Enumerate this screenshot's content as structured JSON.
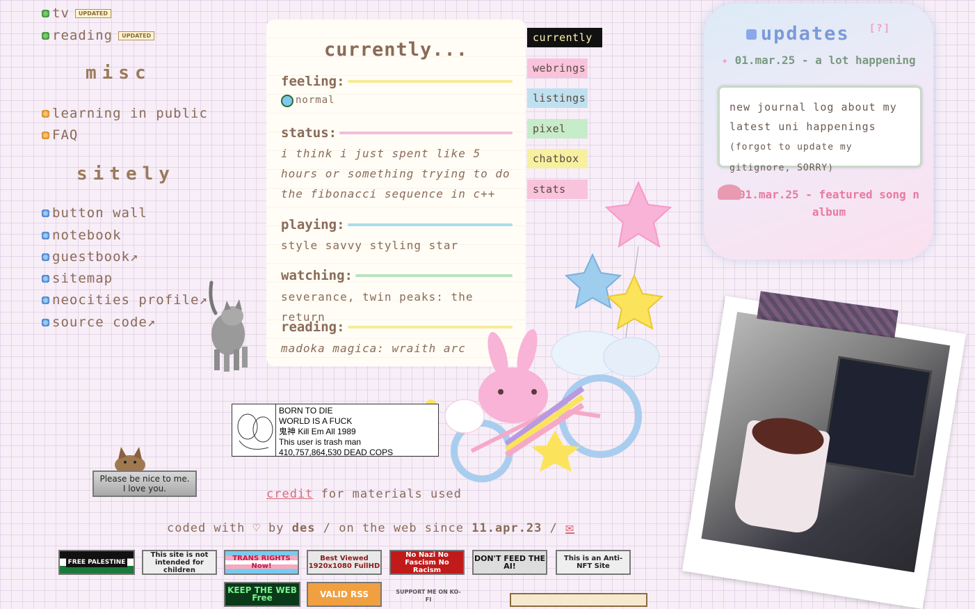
{
  "nav": {
    "top_items": [
      {
        "label": "tv",
        "badge": "UPDATED"
      },
      {
        "label": "reading",
        "badge": "UPDATED"
      }
    ],
    "misc_heading": "misc",
    "misc_items": [
      {
        "label": "learning in public"
      },
      {
        "label": "FAQ"
      }
    ],
    "sitely_heading": "sitely",
    "sitely_items": [
      {
        "label": "button wall"
      },
      {
        "label": "notebook"
      },
      {
        "label": "guestbook↗"
      },
      {
        "label": "sitemap"
      },
      {
        "label": "neocities profile↗"
      },
      {
        "label": "source code↗"
      }
    ]
  },
  "currently": {
    "title": "currently...",
    "feeling_label": "feeling:",
    "feeling_value": "normal",
    "status_label": "status:",
    "status_value": "i think i just spent like 5 hours or something trying to do the fibonacci sequence in c++",
    "playing_label": "playing:",
    "playing_value": "style savvy styling star",
    "watching_label": "watching:",
    "watching_value": "severance, twin peaks: the return",
    "reading_label": "reading:",
    "reading_value": "madoka magica: wraith arc"
  },
  "tabs": [
    {
      "label": "currently",
      "color": "#111111",
      "text": "#fff4b0"
    },
    {
      "label": "webrings",
      "color": "#f9c3dc",
      "text": "#5a4a40"
    },
    {
      "label": "listings",
      "color": "#bfe0ef",
      "text": "#5a4a40"
    },
    {
      "label": "pixel",
      "color": "#c7ecc9",
      "text": "#5a4a40"
    },
    {
      "label": "chatbox",
      "color": "#f6f0a0",
      "text": "#5a4a40"
    },
    {
      "label": "stats",
      "color": "#f9c3dc",
      "text": "#5a4a40"
    }
  ],
  "updates": {
    "title": "updates",
    "help": "[?]",
    "entry1_date": "01.mar.25 - a lot happening",
    "entry1_text": "new journal log about my latest uni happenings",
    "entry1_small": "(forgot to update my gitignore, SORRY)",
    "entry2_date": "01.mar.25 - featured song n album"
  },
  "stamp_left": {
    "line1": "Please be nice to me.",
    "line2": "I love you."
  },
  "stamp_center": {
    "line1": "BORN TO DIE",
    "line2": "WORLD IS A FUCK",
    "line3": "鬼神 Kill Em All 1989",
    "line4": "This user is trash man",
    "line5": "410,757,864,530 DEAD COPS"
  },
  "credit": {
    "link": "credit",
    "rest": "for materials used"
  },
  "footer": {
    "coded_with": "coded with ♡ by",
    "author": "des",
    "since": "/ on the web since",
    "date": "11.apr.23",
    "slash": "/",
    "mail_icon": "envelope-icon"
  },
  "buttons": [
    {
      "label": "FREE PALESTINE"
    },
    {
      "label": "This site is not intended for children"
    },
    {
      "label": "TRANS RIGHTS Now!"
    },
    {
      "label": "Best Viewed 1920x1080 FullHD"
    },
    {
      "label": "No Nazi No Fascism No Racism"
    },
    {
      "label": "DON'T FEED THE AI!"
    },
    {
      "label": "This is an Anti-NFT Site"
    },
    {
      "label": "KEEP THE WEB Free"
    },
    {
      "label": "VALID RSS"
    },
    {
      "label": "SUPPORT ME ON KO-FI"
    }
  ]
}
